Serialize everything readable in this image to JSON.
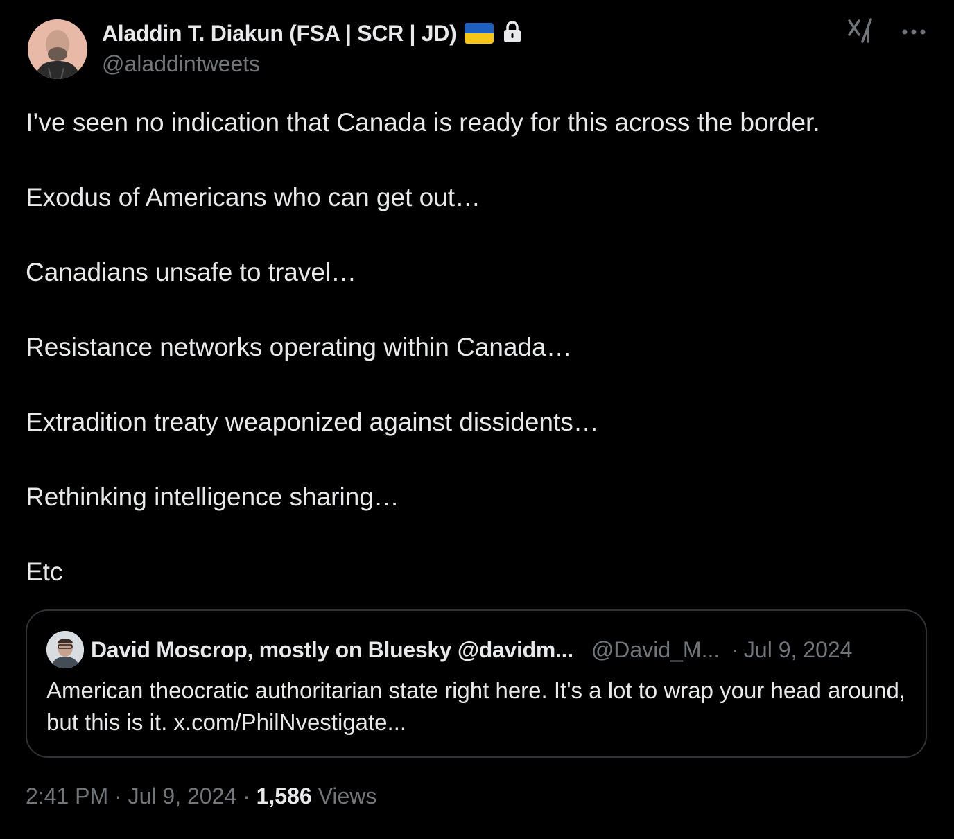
{
  "author": {
    "display_name": "Aladdin T. Diakun (FSA | SCR | JD)",
    "handle": "@aladdintweets",
    "flag_icon": "ukraine-flag-icon",
    "protected_icon": "lock-icon",
    "flag_colors": [
      "#1f5fbf",
      "#f5c518"
    ]
  },
  "header_actions": {
    "grok_icon": "grok-icon",
    "more_icon": "more-icon"
  },
  "body": {
    "paragraphs": [
      "I’ve seen no indication that Canada is ready for this across the border.",
      "Exodus of Americans who can get out…",
      "Canadians unsafe to travel…",
      "Resistance networks operating within Canada…",
      "Extradition treaty weaponized against dissidents…",
      "Rethinking intelligence sharing…",
      "Etc"
    ]
  },
  "quoted_tweet": {
    "display_name": "David Moscrop, mostly on Bluesky @davidm...",
    "handle": "@David_M...",
    "separator": "·",
    "date": "Jul 9, 2024",
    "text": "American theocratic authoritarian state right here. It's a lot to wrap your head around, but this is it. x.com/PhilNvestigate..."
  },
  "meta": {
    "time": "2:41 PM",
    "separator": "·",
    "date": "Jul 9, 2024",
    "views_count": "1,586",
    "views_label": "Views"
  },
  "colors": {
    "background": "#000000",
    "primary_text": "#e7e9ea",
    "secondary_text": "#71767b",
    "border": "#2f3336"
  }
}
